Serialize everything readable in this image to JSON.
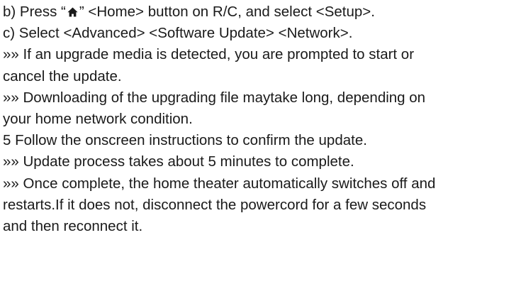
{
  "lines": [
    {
      "pre": "b) Press “",
      "post": "” <Home> button on R/C, and select <Setup>."
    },
    "c) Select <Advanced> <Software Update> <Network>.",
    "»» If an upgrade media is detected, you are prompted to start or",
    "cancel the update.",
    "»» Downloading of the upgrading file maytake long, depending on",
    "your home network condition.",
    "5 Follow the onscreen instructions to confirm the update.",
    "»» Update process takes about 5 minutes to complete.",
    "»» Once complete, the home theater automatically switches off and",
    "restarts.If it does not, disconnect the powercord for a few seconds",
    "and then reconnect it."
  ],
  "icons": {
    "home": "home-icon"
  },
  "colors": {
    "text": "#1a1a1a",
    "background": "#ffffff"
  }
}
